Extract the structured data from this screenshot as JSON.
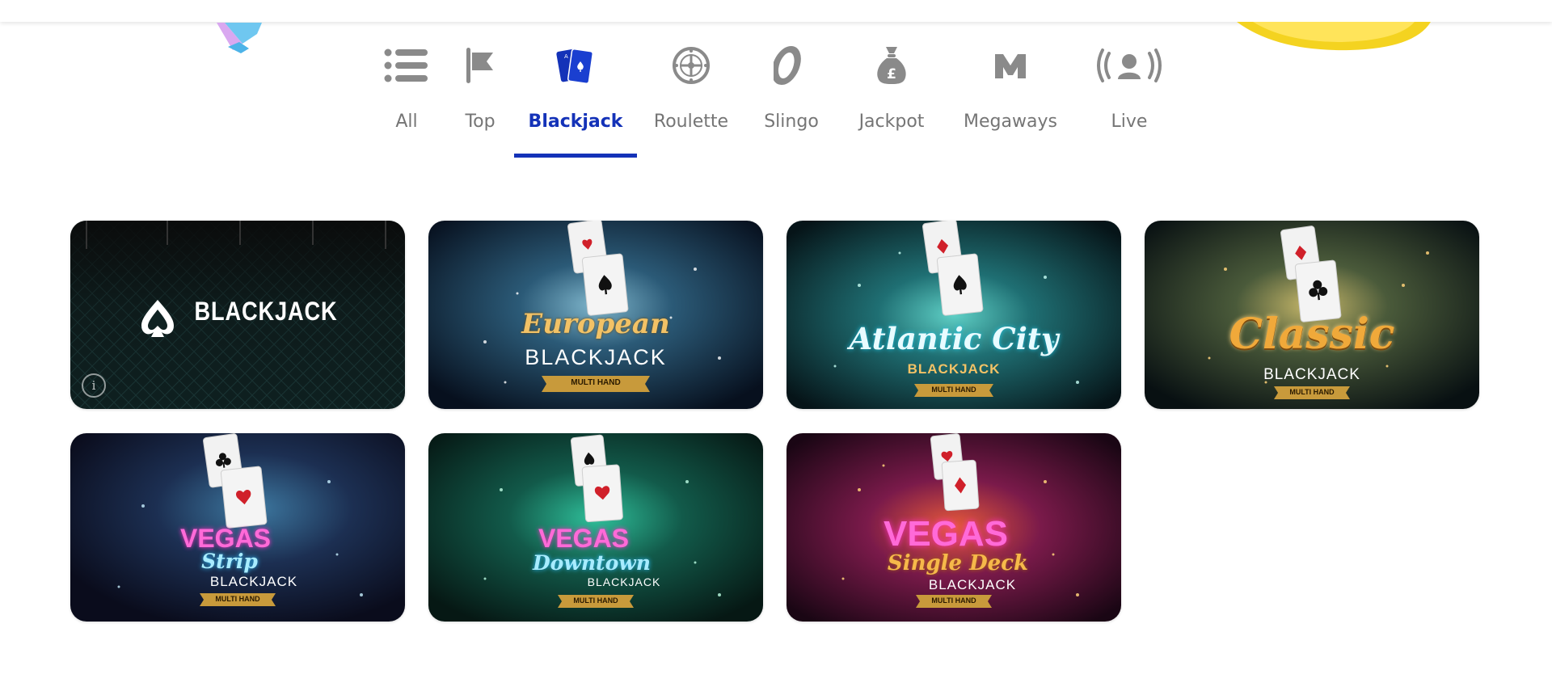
{
  "tabs": [
    {
      "label": "All",
      "icon": "list-icon",
      "active": false
    },
    {
      "label": "Top",
      "icon": "flag-icon",
      "active": false
    },
    {
      "label": "Blackjack",
      "icon": "cards-icon",
      "active": true
    },
    {
      "label": "Roulette",
      "icon": "roulette-icon",
      "active": false
    },
    {
      "label": "Slingo",
      "icon": "slingo-icon",
      "active": false
    },
    {
      "label": "Jackpot",
      "icon": "money-bag-icon",
      "active": false
    },
    {
      "label": "Megaways",
      "icon": "megaways-icon",
      "active": false
    },
    {
      "label": "Live",
      "icon": "live-dealer-icon",
      "active": false
    }
  ],
  "colors": {
    "active_tab": "#1432b8",
    "inactive_tab": "#757575",
    "icon_gray": "#8a8a8a"
  },
  "games": [
    {
      "brand": "BLACKJACK",
      "info_icon": "i"
    },
    {
      "script": "European",
      "brand": "BLACKJACK",
      "ribbon": "MULTI HAND"
    },
    {
      "script": "Atlantic City",
      "brand": "BLACKJACK",
      "ribbon": "MULTI HAND"
    },
    {
      "script": "Classic",
      "brand": "BLACKJACK",
      "ribbon": "MULTI HAND"
    },
    {
      "neon": "VEGAS",
      "script": "Strip",
      "brand": "BLACKJACK",
      "ribbon": "MULTI HAND"
    },
    {
      "neon": "VEGAS",
      "script": "Downtown",
      "brand": "BLACKJACK",
      "ribbon": "MULTI HAND"
    },
    {
      "neon": "VEGAS",
      "script": "Single Deck",
      "brand": "BLACKJACK",
      "ribbon": "MULTI HAND"
    }
  ]
}
